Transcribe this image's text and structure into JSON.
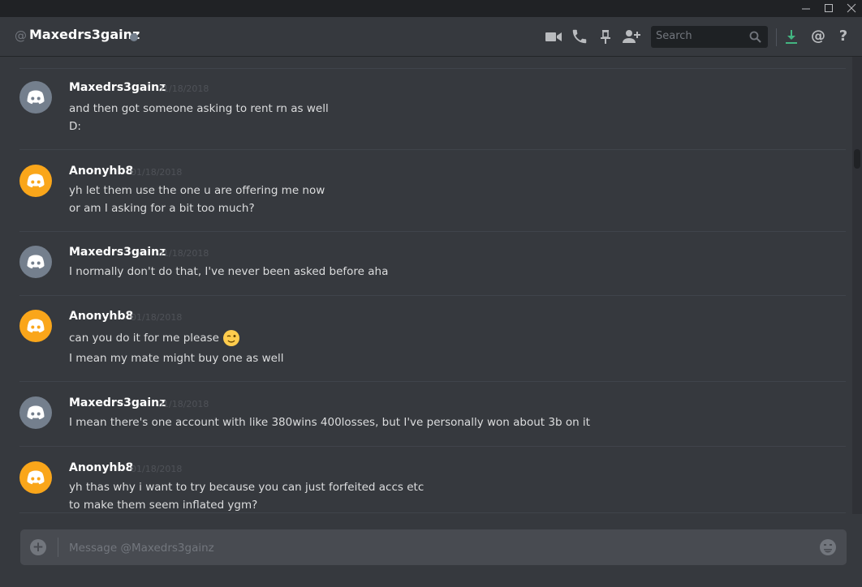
{
  "window": {
    "minimize_icon": "minimize-icon",
    "maximize_icon": "maximize-icon",
    "close_icon": "close-icon"
  },
  "header": {
    "at_symbol": "@",
    "channel_name": "Maxedrs3gainz",
    "status": "offline",
    "search_placeholder": "Search",
    "icons": [
      "video-call-icon",
      "voice-call-icon",
      "pin-icon",
      "add-friend-icon",
      "search-icon",
      "download-icon",
      "mention-icon",
      "help-icon"
    ],
    "help_label": "?",
    "mention_label": "@"
  },
  "messages": [
    {
      "author": "Maxedrs3gainz",
      "timestamp": "01/18/2018",
      "avatar_color": "#747f8d",
      "lines": [
        "and then got someone asking to rent rn as well",
        "D:"
      ]
    },
    {
      "author": "Anonyhb8",
      "timestamp": "01/18/2018",
      "avatar_color": "#faa61a",
      "lines": [
        "yh let them use the one u are offering me now",
        "or am I asking for a bit too much?"
      ]
    },
    {
      "author": "Maxedrs3gainz",
      "timestamp": "01/18/2018",
      "avatar_color": "#747f8d",
      "lines": [
        "I normally don't do that, I've never been asked before aha"
      ]
    },
    {
      "author": "Anonyhb8",
      "timestamp": "01/18/2018",
      "avatar_color": "#faa61a",
      "lines": [
        "can you do it for me please",
        "I mean my mate might buy one as well"
      ],
      "emoji": "wink-emoji"
    },
    {
      "author": "Maxedrs3gainz",
      "timestamp": "01/18/2018",
      "avatar_color": "#747f8d",
      "lines": [
        "I mean there's one account with like 380wins 400losses, but I've personally won about 3b on it"
      ]
    },
    {
      "author": "Anonyhb8",
      "timestamp": "01/18/2018",
      "avatar_color": "#faa61a",
      "lines": [
        "yh thas why i want to try because you can just forfeited accs etc",
        "to make them seem inflated ygm?"
      ]
    }
  ],
  "composer": {
    "placeholder": "Message @Maxedrs3gainz",
    "value": "",
    "plus_label": "+",
    "emoji_icon": "emoji-picker-icon"
  },
  "colors": {
    "background": "#36393e",
    "accent_download": "#43b581",
    "orange_avatar": "#faa61a",
    "grey_avatar": "#747f8d"
  }
}
